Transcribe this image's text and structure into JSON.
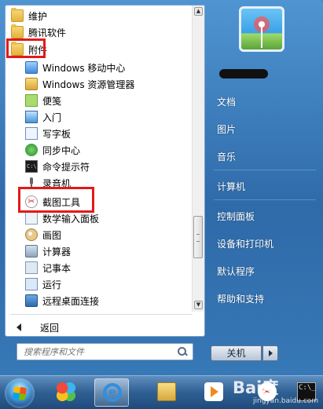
{
  "programs": [
    {
      "label": "维护",
      "kind": "folder",
      "icon": "folder-icon"
    },
    {
      "label": "腾讯软件",
      "kind": "folder",
      "icon": "folder-icon"
    },
    {
      "label": "附件",
      "kind": "folder",
      "icon": "folder-icon"
    },
    {
      "label": "Windows 移动中心",
      "kind": "app",
      "icon": "mobility-center-icon"
    },
    {
      "label": "Windows 资源管理器",
      "kind": "app",
      "icon": "explorer-icon"
    },
    {
      "label": "便笺",
      "kind": "app",
      "icon": "sticky-notes-icon"
    },
    {
      "label": "入门",
      "kind": "app",
      "icon": "getting-started-icon"
    },
    {
      "label": "写字板",
      "kind": "app",
      "icon": "wordpad-icon"
    },
    {
      "label": "同步中心",
      "kind": "app",
      "icon": "sync-center-icon"
    },
    {
      "label": "命令提示符",
      "kind": "app",
      "icon": "command-prompt-icon"
    },
    {
      "label": "录音机",
      "kind": "app",
      "icon": "microphone-icon"
    },
    {
      "label": "截图工具",
      "kind": "app",
      "icon": "snipping-tool-icon"
    },
    {
      "label": "数学输入面板",
      "kind": "app",
      "icon": "math-input-icon"
    },
    {
      "label": "画图",
      "kind": "app",
      "icon": "paint-icon"
    },
    {
      "label": "计算器",
      "kind": "app",
      "icon": "calculator-icon"
    },
    {
      "label": "记事本",
      "kind": "app",
      "icon": "notepad-icon"
    },
    {
      "label": "运行",
      "kind": "app",
      "icon": "run-icon"
    },
    {
      "label": "远程桌面连接",
      "kind": "app",
      "icon": "remote-desktop-icon"
    }
  ],
  "back_label": "返回",
  "search": {
    "placeholder": "搜索程序和文件"
  },
  "right_menu": {
    "items": [
      {
        "label": "文档"
      },
      {
        "label": "图片"
      },
      {
        "label": "音乐"
      },
      {
        "label": "计算机"
      },
      {
        "label": "控制面板"
      },
      {
        "label": "设备和打印机"
      },
      {
        "label": "默认程序"
      },
      {
        "label": "帮助和支持"
      }
    ]
  },
  "shutdown_label": "关机",
  "cmd_glyph": "C:\\",
  "taskbar": {
    "apps": [
      {
        "icon": "pinned-app-icon"
      },
      {
        "icon": "internet-explorer-icon",
        "glyph": "e"
      },
      {
        "icon": "file-explorer-icon"
      },
      {
        "icon": "media-player-icon"
      },
      {
        "icon": "snipping-tool-icon"
      },
      {
        "icon": "command-prompt-icon",
        "glyph": "C:\\_"
      }
    ]
  },
  "watermark": {
    "text": "Bai度",
    "sub": "jingyan.baidu.com"
  },
  "colors": {
    "highlight_box": "#e21a1a",
    "menu_blue": "#2f6aa9"
  }
}
